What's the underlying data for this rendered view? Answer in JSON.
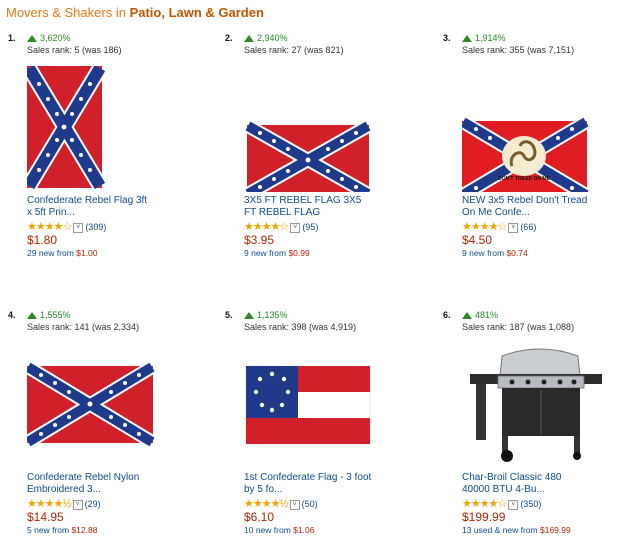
{
  "header": {
    "prefix": "Movers & Shakers in",
    "category": "Patio, Lawn & Garden"
  },
  "items": [
    {
      "rank": "1.",
      "percent": "3,620%",
      "sales_rank": "Sales rank: 5 (was 186)",
      "title_line1": "Confederate Rebel Flag 3ft",
      "title_line2": "x 5ft Prin...",
      "review_count": "(309)",
      "rating": 4.0,
      "price": "$1.80",
      "offers_count": "29 new",
      "offers_from_label": "from",
      "offers_price": "$1.00",
      "image": "confederate-battle-flag-vertical"
    },
    {
      "rank": "2.",
      "percent": "2,940%",
      "sales_rank": "Sales rank: 27 (was 821)",
      "title_line1": "3X5 FT REBEL FLAG 3X5",
      "title_line2": "FT REBEL FLAG",
      "review_count": "(95)",
      "rating": 4.0,
      "price": "$3.95",
      "offers_count": "9 new",
      "offers_from_label": "from",
      "offers_price": "$0.99",
      "image": "confederate-battle-flag"
    },
    {
      "rank": "3.",
      "percent": "1,914%",
      "sales_rank": "Sales rank: 355 (was 7,151)",
      "title_line1": "NEW 3x5 Rebel Don't Tread",
      "title_line2": "On Me Confe...",
      "review_count": "(66)",
      "rating": 4.0,
      "price": "$4.50",
      "offers_count": "9 new",
      "offers_from_label": "from",
      "offers_price": "$0.74",
      "image": "dont-tread-on-me-rebel-flag",
      "flag_text": "DON'T TREAD ON ME"
    },
    {
      "rank": "4.",
      "percent": "1,555%",
      "sales_rank": "Sales rank: 141 (was 2,334)",
      "title_line1": "Confederate Rebel Nylon",
      "title_line2": "Embroidered 3...",
      "review_count": "(29)",
      "rating": 4.5,
      "price": "$14.95",
      "offers_count": "5 new",
      "offers_from_label": "from",
      "offers_price": "$12.88",
      "image": "confederate-battle-flag-nylon"
    },
    {
      "rank": "5.",
      "percent": "1,135%",
      "sales_rank": "Sales rank: 398 (was 4,919)",
      "title_line1": "1st Confederate Flag - 3 foot",
      "title_line2": "by 5 fo...",
      "review_count": "(50)",
      "rating": 4.5,
      "price": "$6.10",
      "offers_count": "10 new",
      "offers_from_label": "from",
      "offers_price": "$1.06",
      "image": "stars-and-bars-flag"
    },
    {
      "rank": "6.",
      "percent": "481%",
      "sales_rank": "Sales rank: 187 (was 1,088)",
      "title_line1": "Char-Broil Classic 480",
      "title_line2": "40000 BTU 4-Bu...",
      "review_count": "(350)",
      "rating": 4.0,
      "price": "$199.99",
      "offers_count": "13 used & new",
      "offers_from_label": "from",
      "offers_price": "$169.99",
      "image": "gas-grill"
    }
  ]
}
